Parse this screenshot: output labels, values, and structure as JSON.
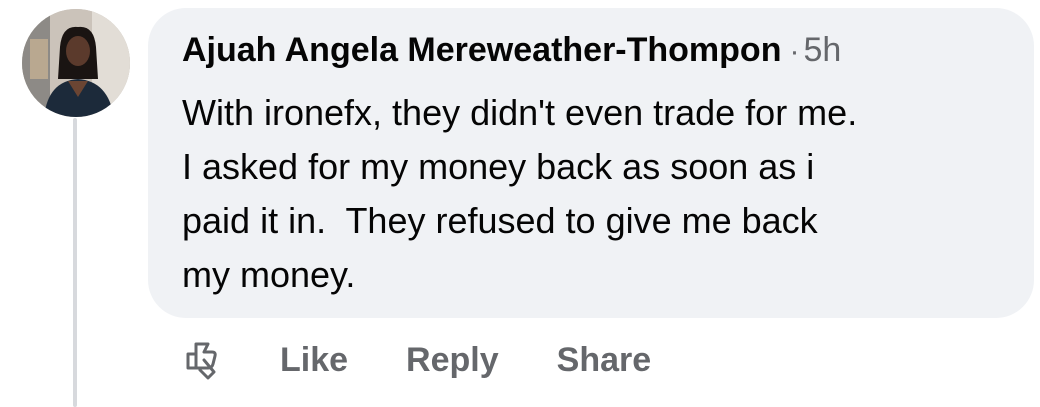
{
  "comment": {
    "author": "Ajuah Angela Mereweather-Thompon",
    "separator": "·",
    "time": "5h",
    "text": "With ironefx, they didn't even trade for me.\nI asked for my money back as soon as i\npaid it in.  They refused to give me back\nmy money."
  },
  "actions": {
    "react_icon": "react-icon",
    "like_label": "Like",
    "reply_label": "Reply",
    "share_label": "Share"
  },
  "colors": {
    "bubble": "#f0f2f5",
    "text": "#050505",
    "secondary": "#65676b",
    "thread_line": "#d7d9dd"
  }
}
